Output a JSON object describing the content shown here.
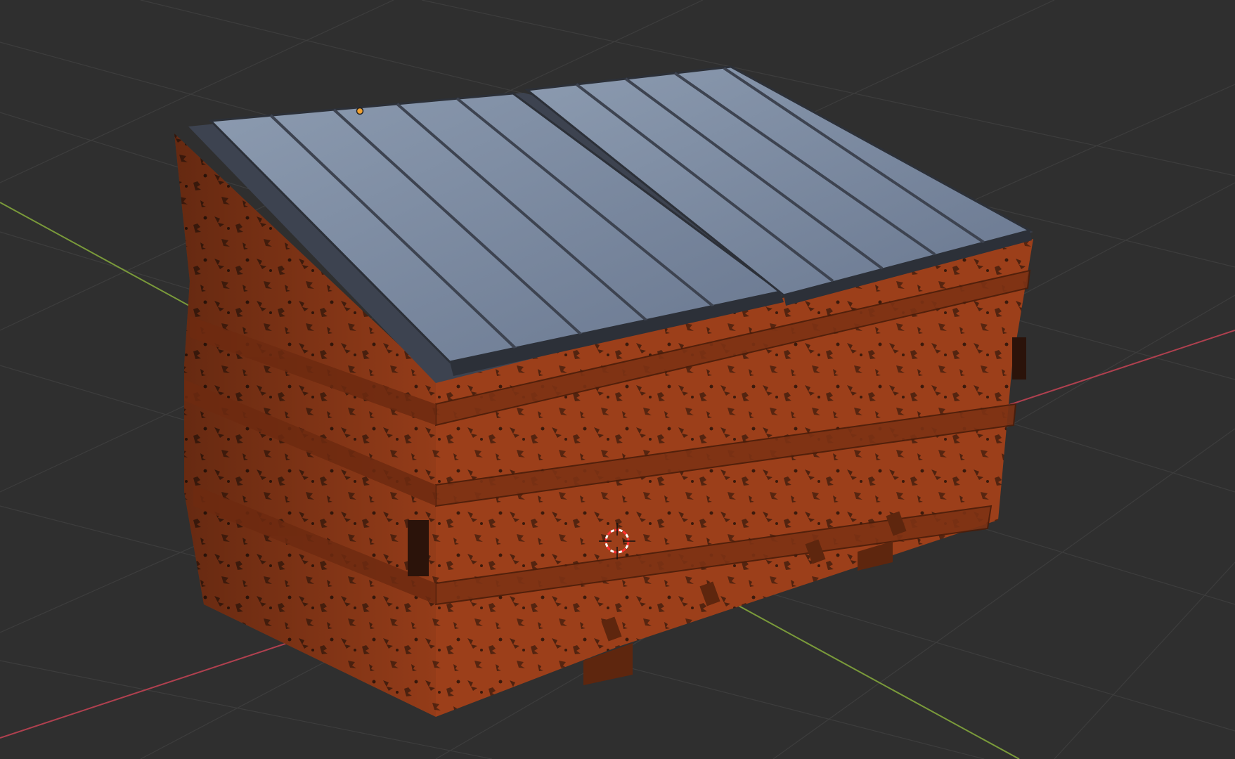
{
  "viewport": {
    "background_color": "#2f2f2f",
    "grid_line_color": "#3c3c3c",
    "x_axis_color": "#b0404f",
    "y_axis_color": "#7a9a3a"
  },
  "dumpster": {
    "body_color": "#9c3f1a",
    "body_shade_color": "#6e2a10",
    "rust_spot_color": "#3b1a0c",
    "lid_color": "#6f7f93",
    "lid_highlight_color": "#8c9bb0",
    "lid_groove_color": "#3d4350"
  },
  "overlays": {
    "origin_point_color": "#f0a030",
    "cursor_3d_color": "#ff3030"
  }
}
